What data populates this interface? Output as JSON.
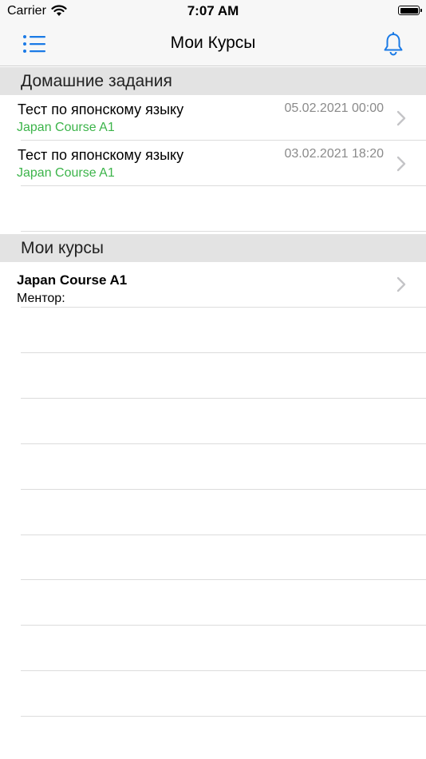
{
  "status_bar": {
    "carrier": "Carrier",
    "time": "7:07 AM"
  },
  "nav": {
    "title": "Мои Курсы",
    "accent_color": "#1a7ae6"
  },
  "sections": {
    "homework_header": "Домашние задания",
    "courses_header": "Мои курсы"
  },
  "homework": [
    {
      "title": "Тест по японскому языку",
      "course": "Japan Course A1",
      "date": "05.02.2021 00:00"
    },
    {
      "title": "Тест по японскому языку",
      "course": "Japan Course A1",
      "date": "03.02.2021 18:20"
    }
  ],
  "courses": [
    {
      "title": "Japan Course A1",
      "mentor_label": "Ментор:"
    }
  ],
  "colors": {
    "course_subtitle": "#3cb44a",
    "date_text": "#8a8a8a",
    "section_bg": "#e3e3e3"
  }
}
